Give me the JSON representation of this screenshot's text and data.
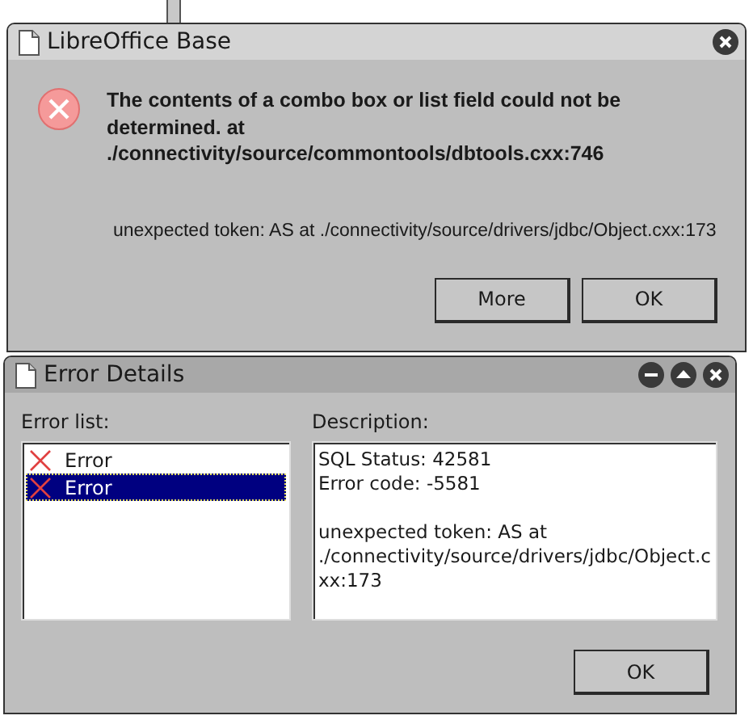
{
  "dialog": {
    "title": "LibreOffice Base",
    "message": "The contents of a combo box or list field could not be determined. at ./connectivity/source/commontools/dbtools.cxx:746",
    "detail": "unexpected token: AS at ./connectivity/source/drivers/jdbc/Object.cxx:173",
    "buttons": [
      {
        "label": "More"
      },
      {
        "label": "OK"
      }
    ]
  },
  "details_dialog": {
    "title": "Error Details",
    "error_list": {
      "label": "Error list:",
      "items": [
        {
          "label": "Error",
          "selected": false
        },
        {
          "label": "Error",
          "selected": true
        }
      ]
    },
    "description": {
      "label": "Description:",
      "paragraphs": [
        "SQL Status: 42581\nError code: -5581",
        "unexpected token: AS at ./connectivity/source/drivers/jdbc/Object.cxx:173"
      ]
    },
    "buttons": [
      {
        "label": "OK"
      }
    ]
  }
}
